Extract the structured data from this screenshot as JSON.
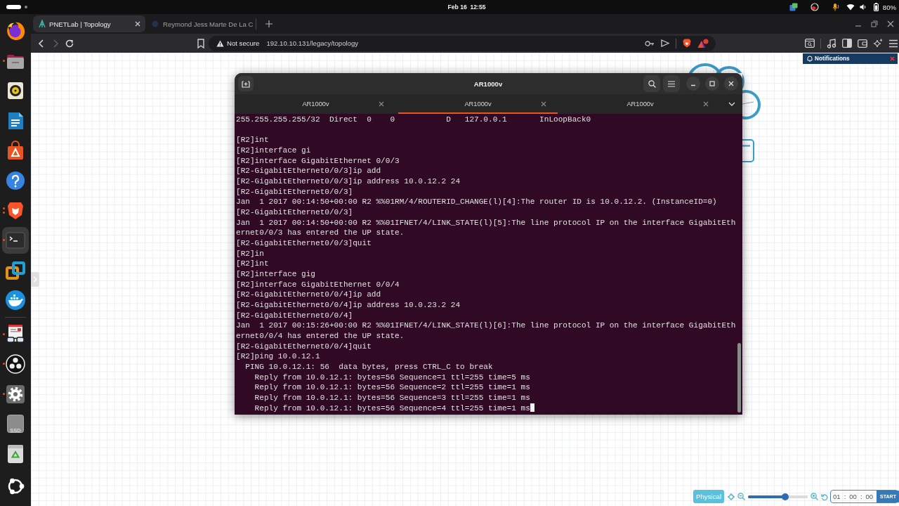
{
  "top_bar": {
    "clock": "Feb 16  12:55",
    "battery": "80%"
  },
  "dock": {
    "pinned": [
      {
        "kind": "fox",
        "running": false,
        "multiple_windows": false,
        "selected": false
      },
      {
        "kind": "folder",
        "running": true,
        "multiple_windows": false,
        "selected": false
      },
      {
        "kind": "speaker",
        "running": false,
        "multiple_windows": false,
        "selected": false
      },
      {
        "kind": "writer",
        "running": false,
        "multiple_windows": false,
        "selected": false
      },
      {
        "kind": "bag",
        "running": false,
        "multiple_windows": false,
        "selected": false
      },
      {
        "kind": "help",
        "running": false,
        "multiple_windows": false,
        "selected": false
      },
      {
        "kind": "lion",
        "running": true,
        "multiple_windows": true,
        "selected": false
      },
      {
        "kind": "terminal",
        "running": true,
        "multiple_windows": false,
        "selected": true
      },
      {
        "kind": "squares",
        "running": false,
        "multiple_windows": false,
        "selected": false
      },
      {
        "kind": "whale",
        "running": false,
        "multiple_windows": false,
        "selected": false
      }
    ],
    "others": [
      {
        "kind": "reader",
        "running": true,
        "multiple_windows": false,
        "selected": false
      },
      {
        "kind": "aperture",
        "running": true,
        "multiple_windows": false,
        "selected": false
      },
      {
        "kind": "gear",
        "running": true,
        "multiple_windows": false,
        "selected": false
      },
      {
        "kind": "drive",
        "label": "SSD",
        "running": false,
        "multiple_windows": false,
        "selected": false
      },
      {
        "kind": "trash",
        "running": false,
        "multiple_windows": false,
        "selected": false
      }
    ]
  },
  "browser": {
    "tabs": [
      {
        "title": "PNETLab | Topology",
        "selected": true
      },
      {
        "title": "Reymond Jess Marte De La C",
        "selected": false
      }
    ],
    "nav": [
      {
        "kind": "back",
        "disabled": false
      },
      {
        "kind": "forward",
        "disabled": true
      },
      {
        "kind": "reload",
        "disabled": false
      }
    ],
    "address_bar": {
      "security": "Not secure",
      "url": "192.10.10.131/legacy/topology"
    }
  },
  "notifications": {
    "title": "Notifications"
  },
  "terminal": {
    "title": "AR1000v",
    "tabs": [
      {
        "label": "AR1000v",
        "selected": false
      },
      {
        "label": "AR1000v",
        "selected": true
      },
      {
        "label": "AR1000v",
        "selected": false
      }
    ],
    "blocks": [
      {
        "lines": [
          "255.255.255.255/32  Direct  0    0           D   127.0.0.1       InLoopBack0"
        ]
      },
      {
        "lines": [
          "[R2]int",
          "[R2]interface gi",
          "[R2]interface GigabitEthernet 0/0/3",
          "[R2-GigabitEthernet0/0/3]ip add",
          "[R2-GigabitEthernet0/0/3]ip address 10.0.12.2 24",
          "[R2-GigabitEthernet0/0/3]",
          "Jan  1 2017 00:14:50+00:00 R2 %%01RM/4/ROUTERID_CHANGE(l)[4]:The router ID is 10.0.12.2. (InstanceID=0)",
          "[R2-GigabitEthernet0/0/3]",
          "Jan  1 2017 00:14:50+00:00 R2 %%01IFNET/4/LINK_STATE(l)[5]:The line protocol IP on the interface GigabitEth",
          "ernet0/0/3 has entered the UP state.",
          "[R2-GigabitEthernet0/0/3]quit",
          "[R2]in",
          "[R2]int",
          "[R2]interface gig",
          "[R2]interface GigabitEthernet 0/0/4",
          "[R2-GigabitEthernet0/0/4]ip add",
          "[R2-GigabitEthernet0/0/4]ip address 10.0.23.2 24",
          "[R2-GigabitEthernet0/0/4]",
          "Jan  1 2017 00:15:26+00:00 R2 %%01IFNET/4/LINK_STATE(l)[6]:The line protocol IP on the interface GigabitEth",
          "ernet0/0/4 has entered the UP state.",
          "[R2-GigabitEthernet0/0/4]quit",
          "[R2]ping 10.0.12.1",
          "  PING 10.0.12.1: 56  data bytes, press CTRL_C to break",
          "    Reply from 10.0.12.1: bytes=56 Sequence=1 ttl=255 time=5 ms",
          "    Reply from 10.0.12.1: bytes=56 Sequence=2 ttl=255 time=1 ms",
          "    Reply from 10.0.12.1: bytes=56 Sequence=3 ttl=255 time=1 ms",
          "    Reply from 10.0.12.1: bytes=56 Sequence=4 ttl=255 time=1 ms"
        ]
      }
    ]
  },
  "canvas_controls": {
    "mode": "Physical",
    "zoom": {
      "level": 0.62
    },
    "timer": [
      {
        "kind": "field",
        "value": "01"
      },
      {
        "kind": "separator",
        "text": ":"
      },
      {
        "kind": "field",
        "value": "00"
      },
      {
        "kind": "separator",
        "text": ":"
      },
      {
        "kind": "field",
        "value": "00"
      }
    ],
    "start": "START"
  }
}
